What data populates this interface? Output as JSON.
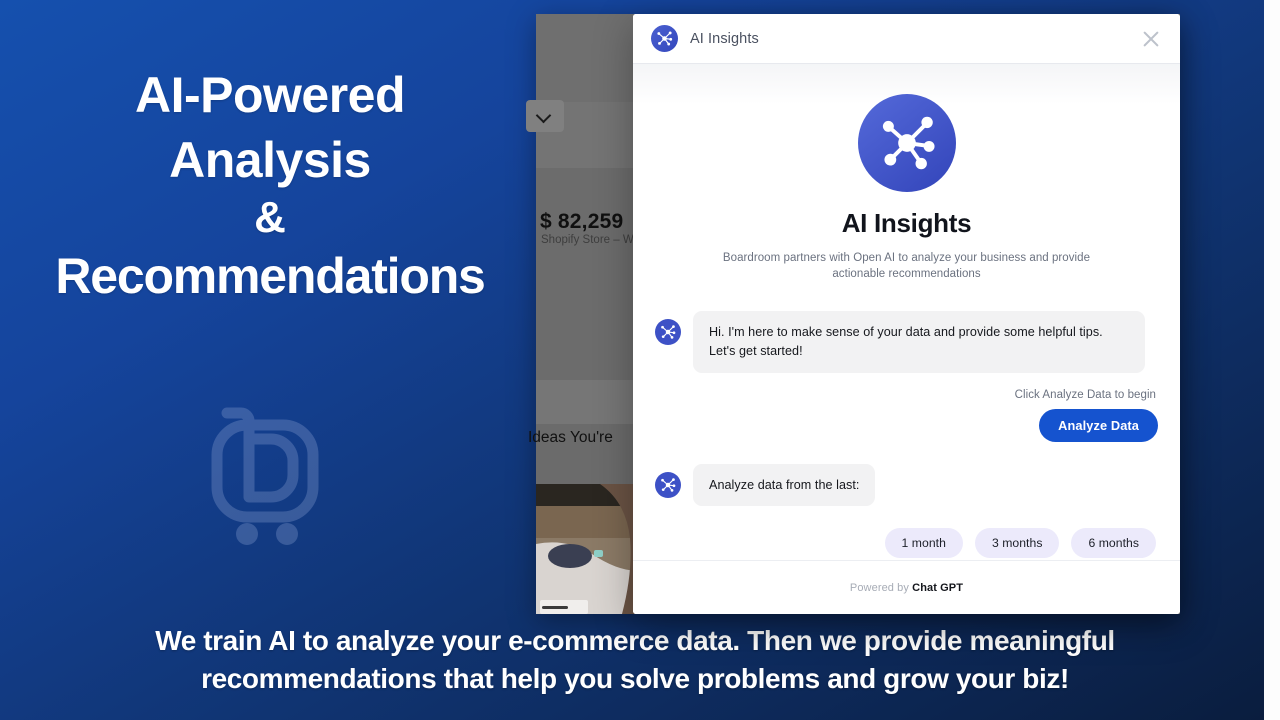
{
  "theme": {
    "bg_blue_start": "#1550ae",
    "bg_navy_end": "#0a1d3e",
    "accent_blue": "#1553cf",
    "chip_bg": "#eceafb",
    "logo_blue": "#4056c8"
  },
  "promo": {
    "headline_line1": "AI-Powered",
    "headline_line2": "Analysis",
    "headline_line3": "&",
    "headline_line4": "Recommendations",
    "logo_name": "boardroom-cart-logo",
    "caption": "We train AI to analyze your e-commerce data. Then we provide meaningful recommendations that help you solve problems and grow your biz!"
  },
  "background_app": {
    "kpi_value": "$ 82,259",
    "kpi_label": "Shopify Store – Wes",
    "section_label": "Ideas You're",
    "dropdown_icon": "chevron-down-icon",
    "photo_alt": "person-at-desk-photo"
  },
  "modal": {
    "header": {
      "title": "AI Insights",
      "avatar_icon": "ai-network-icon",
      "close_icon": "close-icon"
    },
    "hero": {
      "logo_icon": "ai-network-icon",
      "title": "AI Insights",
      "subtitle": "Boardroom partners with Open AI to analyze your business and provide actionable recommendations"
    },
    "messages": [
      {
        "avatar_icon": "ai-network-icon",
        "text": "Hi. I'm here to make sense of your data and provide some helpful tips. Let's get started!"
      },
      {
        "avatar_icon": "ai-network-icon",
        "text": "Analyze data from the last:"
      }
    ],
    "hint": "Click Analyze Data to begin",
    "cta_label": "Analyze Data",
    "chips": [
      {
        "label": "1 month"
      },
      {
        "label": "3 months"
      },
      {
        "label": "6 months"
      }
    ],
    "footer": {
      "powered_prefix": "Powered by ",
      "powered_brand": "Chat GPT"
    }
  }
}
